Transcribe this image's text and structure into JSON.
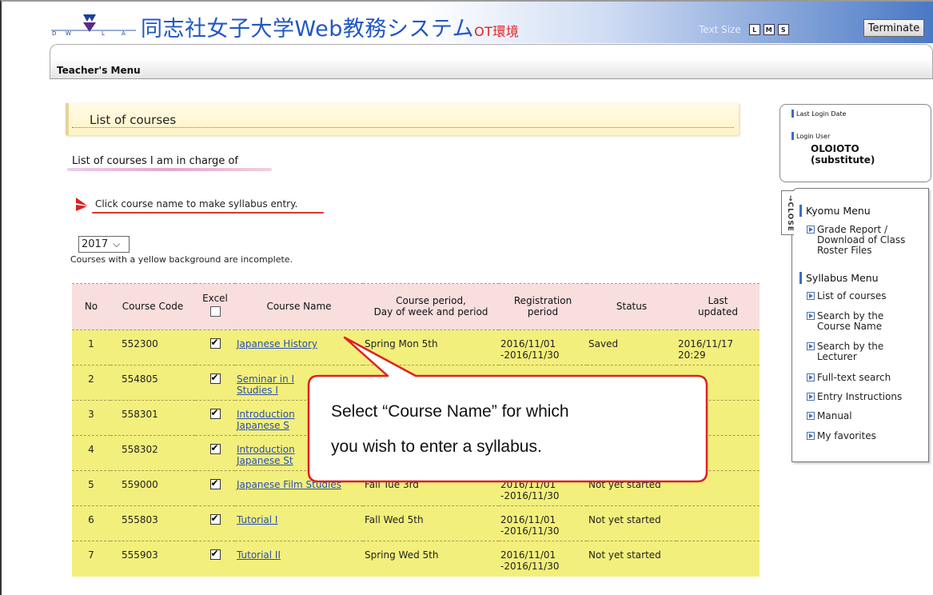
{
  "header": {
    "logo_text": "DWCLA",
    "system_title": "同志社女子大学Web教務システム",
    "system_sub": "OT環境",
    "text_size_label": "Text Size",
    "size_buttons": [
      "L",
      "M",
      "S"
    ],
    "terminate_label": "Terminate"
  },
  "menubar": {
    "label": "Teacher's Menu"
  },
  "main": {
    "title": "List of courses",
    "subheading": "List of courses I am in charge of",
    "click_note": "Click course name to make syllabus entry.",
    "year": "2017",
    "year_note": "Courses with a yellow background are incomplete."
  },
  "table": {
    "headers": {
      "no": "No",
      "code": "Course Code",
      "excel": "Excel",
      "name": "Course Name",
      "period_1": "Course period,",
      "period_2": "Day of week and period",
      "reg_1": "Registration",
      "reg_2": "period",
      "status": "Status",
      "updated_1": "Last",
      "updated_2": "updated"
    },
    "rows": [
      {
        "no": "1",
        "code": "552300",
        "name_1": "Japanese History",
        "name_2": "",
        "period": "Spring Mon 5th",
        "reg_1": "2016/11/01",
        "reg_2": "-2016/11/30",
        "status": "Saved",
        "upd_1": "2016/11/17",
        "upd_2": "20:29"
      },
      {
        "no": "2",
        "code": "554805",
        "name_1": "Seminar in I",
        "name_2": "Studies I",
        "period": "",
        "reg_1": "",
        "reg_2": "",
        "status": "",
        "upd_1": "",
        "upd_2": ""
      },
      {
        "no": "3",
        "code": "558301",
        "name_1": "Introduction",
        "name_2": "Japanese S",
        "period": "",
        "reg_1": "",
        "reg_2": "",
        "status": "",
        "upd_1": "",
        "upd_2": ""
      },
      {
        "no": "4",
        "code": "558302",
        "name_1": "Introduction",
        "name_2": "Japanese St",
        "period": "",
        "reg_1": "",
        "reg_2": "",
        "status": "",
        "upd_1": "",
        "upd_2": ""
      },
      {
        "no": "5",
        "code": "559000",
        "name_1": "Japanese Film Studies",
        "name_2": "",
        "period": "Fall Tue 3rd",
        "reg_1": "2016/11/01",
        "reg_2": "-2016/11/30",
        "status": "Not yet started",
        "upd_1": "",
        "upd_2": ""
      },
      {
        "no": "6",
        "code": "555803",
        "name_1": "Tutorial I",
        "name_2": "",
        "period": "Fall Wed 5th",
        "reg_1": "2016/11/01",
        "reg_2": "-2016/11/30",
        "status": "Not yet started",
        "upd_1": "",
        "upd_2": ""
      },
      {
        "no": "7",
        "code": "555903",
        "name_1": "Tutorial II",
        "name_2": "",
        "period": "Spring Wed 5th",
        "reg_1": "2016/11/01",
        "reg_2": "-2016/11/30",
        "status": "Not yet started",
        "upd_1": "",
        "upd_2": ""
      }
    ]
  },
  "callout": {
    "line_1": "Select “Course Name” for which",
    "line_2": "you wish to enter a syllabus."
  },
  "login": {
    "last_login_label": "Last Login Date",
    "user_label": "Login User",
    "user_name_1": "OLOIOTO",
    "user_name_2": "(substitute)"
  },
  "side_menu": {
    "close_label": "CLOSE",
    "kyomu_title": "Kyomu Menu",
    "kyomu_item_1": "Grade Report /",
    "kyomu_item_2": "Download of Class",
    "kyomu_item_3": "Roster Files",
    "syllabus_title": "Syllabus Menu",
    "items": [
      "List of courses",
      "Search by the",
      "Course Name",
      "Search by the",
      "Lecturer",
      "Full-text search",
      "Entry Instructions",
      "Manual",
      "My favorites"
    ]
  },
  "colors": {
    "title_blue": "#1f57c4",
    "accent_red": "#e02020",
    "row_yellow": "#f3ef7c",
    "header_pink": "#f9dede",
    "link_blue": "#2a4fb0"
  }
}
